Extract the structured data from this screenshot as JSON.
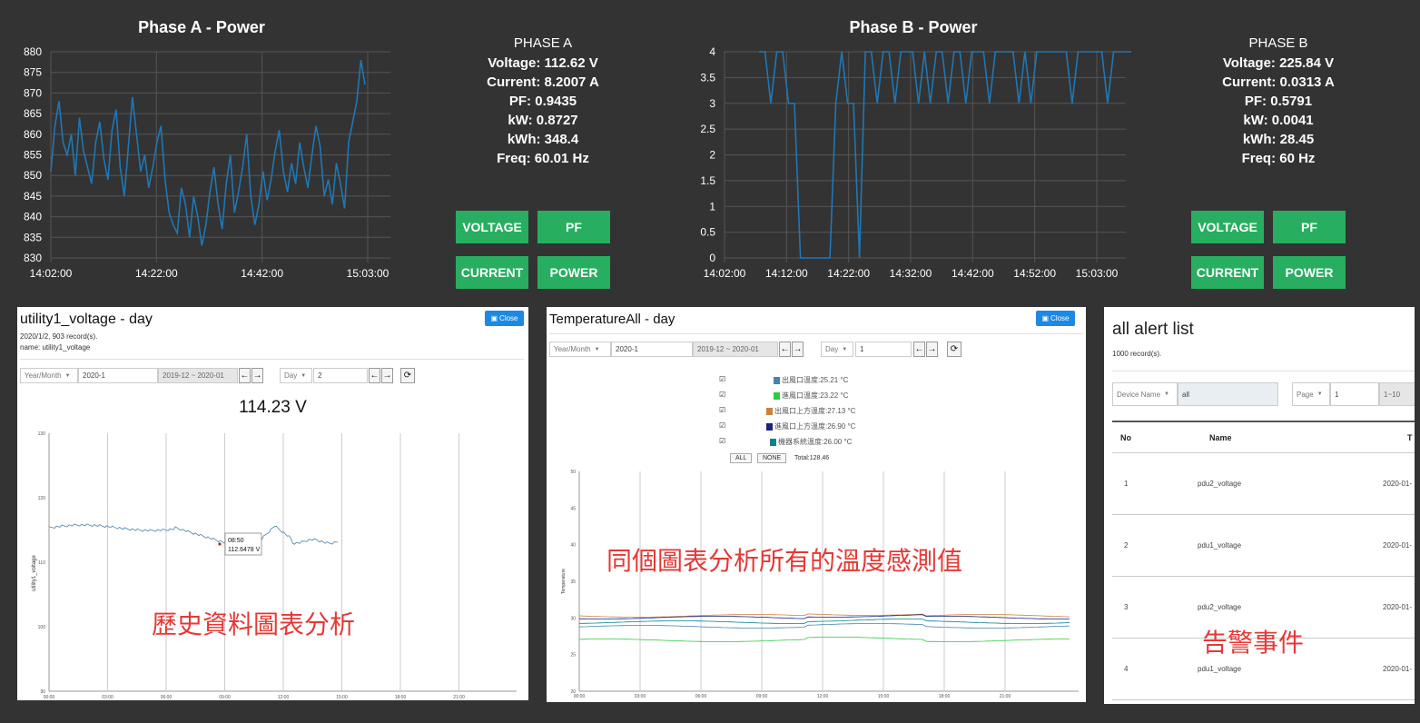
{
  "phase_a": {
    "chart_title": "Phase A - Power",
    "stats_header": "PHASE A",
    "voltage": "Voltage: 112.62 V",
    "current": "Current: 8.2007 A",
    "pf": "PF: 0.9435",
    "kw": "kW: 0.8727",
    "kwh": "kWh: 348.4",
    "freq": "Freq: 60.01 Hz",
    "buttons": {
      "voltage": "VOLTAGE",
      "pf": "PF",
      "current": "CURRENT",
      "power": "POWER"
    }
  },
  "phase_b": {
    "chart_title": "Phase B - Power",
    "stats_header": "PHASE B",
    "voltage": "Voltage: 225.84 V",
    "current": "Current: 0.0313 A",
    "pf": "PF: 0.5791",
    "kw": "kW: 0.0041",
    "kwh": "kWh: 28.45",
    "freq": "Freq: 60 Hz",
    "buttons": {
      "voltage": "VOLTAGE",
      "pf": "PF",
      "current": "CURRENT",
      "power": "POWER"
    }
  },
  "chart_data": [
    {
      "type": "line",
      "title": "Phase A - Power",
      "x_ticks": [
        "14:02:00",
        "14:22:00",
        "14:42:00",
        "15:03:00"
      ],
      "y_ticks": [
        830,
        835,
        840,
        845,
        850,
        855,
        860,
        865,
        870,
        875,
        880
      ],
      "ylim": [
        830,
        880
      ],
      "xlim_minutes": [
        0,
        61
      ],
      "series": [
        {
          "values": [
            851,
            862,
            868,
            858,
            855,
            860,
            850,
            864,
            856,
            852,
            848,
            858,
            863,
            854,
            849,
            861,
            866,
            852,
            845,
            857,
            869,
            860,
            851,
            855,
            847,
            852,
            858,
            862,
            849,
            841,
            838,
            836,
            847,
            843,
            835,
            845,
            840,
            833,
            838,
            846,
            852,
            843,
            837,
            848,
            855,
            841,
            846,
            852,
            860,
            845,
            838,
            843,
            851,
            844,
            849,
            856,
            861,
            851,
            846,
            853,
            848,
            858,
            852,
            847,
            855,
            862,
            857,
            845,
            849,
            843,
            853,
            848,
            842,
            858,
            863,
            868,
            878,
            872
          ]
        }
      ],
      "grid": true
    },
    {
      "type": "line",
      "title": "Phase B - Power",
      "x_ticks": [
        "14:02:00",
        "14:12:00",
        "14:22:00",
        "14:32:00",
        "14:42:00",
        "14:52:00",
        "15:03:00"
      ],
      "y_ticks": [
        0,
        0.5,
        1,
        1.5,
        2,
        2.5,
        3,
        3.5,
        4
      ],
      "ylim": [
        0,
        4
      ],
      "xlim_minutes": [
        0,
        61
      ],
      "series": [
        {
          "values": [
            4,
            4,
            3,
            4,
            4,
            3,
            3,
            0,
            0,
            0,
            0,
            0,
            0,
            3,
            4,
            3,
            3,
            0,
            4,
            4,
            3,
            4,
            4,
            3,
            4,
            4,
            4,
            3,
            4,
            3,
            4,
            4,
            3,
            4,
            4,
            3,
            4,
            4,
            4,
            3,
            4,
            4,
            4,
            4,
            3,
            4,
            3,
            4,
            4,
            4,
            4,
            4,
            4,
            3,
            4,
            4,
            4,
            4,
            4,
            3,
            4,
            4,
            4,
            4
          ]
        }
      ],
      "grid": true
    }
  ],
  "panel_voltage": {
    "title": "utility1_voltage - day",
    "close_label": "Close",
    "meta1": "2020/1/2, 903 record(s).",
    "meta2": "name: utility1_voltage",
    "yearmonth_label": "Year/Month",
    "month_value": "2020-1",
    "range": "2019-12 ~ 2020-01",
    "day_label": "Day",
    "day_value": "2",
    "reading": "114.23 V",
    "ylabel": "utility1_voltage",
    "y_ticks": [
      "130",
      "120",
      "110",
      "100",
      "90"
    ],
    "x_ticks": [
      "00:00",
      "03:00",
      "06:00",
      "09:00",
      "12:00",
      "15:00",
      "18:00",
      "21:00"
    ],
    "tooltip_time": "08:50",
    "tooltip_value": "112.6478 V",
    "overlay": "歷史資料圖表分析"
  },
  "panel_temp": {
    "title": "TemperatureAll - day",
    "close_label": "Close",
    "yearmonth_label": "Year/Month",
    "month_value": "2020-1",
    "range": "2019-12 ~ 2020-01",
    "day_label": "Day",
    "day_value": "1",
    "legend": [
      {
        "label": "出風口溫度:25.21 °C",
        "color": "#4682b4"
      },
      {
        "label": "進風口溫度:23.22 °C",
        "color": "#2ecc40"
      },
      {
        "label": "出風口上方溫度:27.13 °C",
        "color": "#c8823c"
      },
      {
        "label": "進風口上方溫度:26.90 °C",
        "color": "#1a237e"
      },
      {
        "label": "機器系統溫度:26.00 °C",
        "color": "#00838f"
      }
    ],
    "all_label": "ALL",
    "none_label": "NONE",
    "total": "Total:128.46",
    "ylabel": "Temperature",
    "y_ticks": [
      "50",
      "45",
      "40",
      "35",
      "30",
      "25",
      "20"
    ],
    "x_ticks": [
      "00:00",
      "03:00",
      "06:00",
      "09:00",
      "12:00",
      "15:00",
      "18:00",
      "21:00"
    ],
    "overlay": "同個圖表分析所有的溫度感測值"
  },
  "panel_alerts": {
    "title": "all alert list",
    "records": "1000 record(s).",
    "device_name_label": "Device Name",
    "device_value": "all",
    "page_label": "Page",
    "page_value": "1",
    "page_range": "1~10",
    "headers": {
      "no": "No",
      "name": "Name",
      "time": "T"
    },
    "rows": [
      {
        "no": "1",
        "name": "pdu2_voltage",
        "time": "2020-01-"
      },
      {
        "no": "2",
        "name": "pdu1_voltage",
        "time": "2020-01-"
      },
      {
        "no": "3",
        "name": "pdu2_voltage",
        "time": "2020-01-"
      },
      {
        "no": "4",
        "name": "pdu1_voltage",
        "time": "2020-01-"
      }
    ],
    "overlay": "告警事件"
  }
}
